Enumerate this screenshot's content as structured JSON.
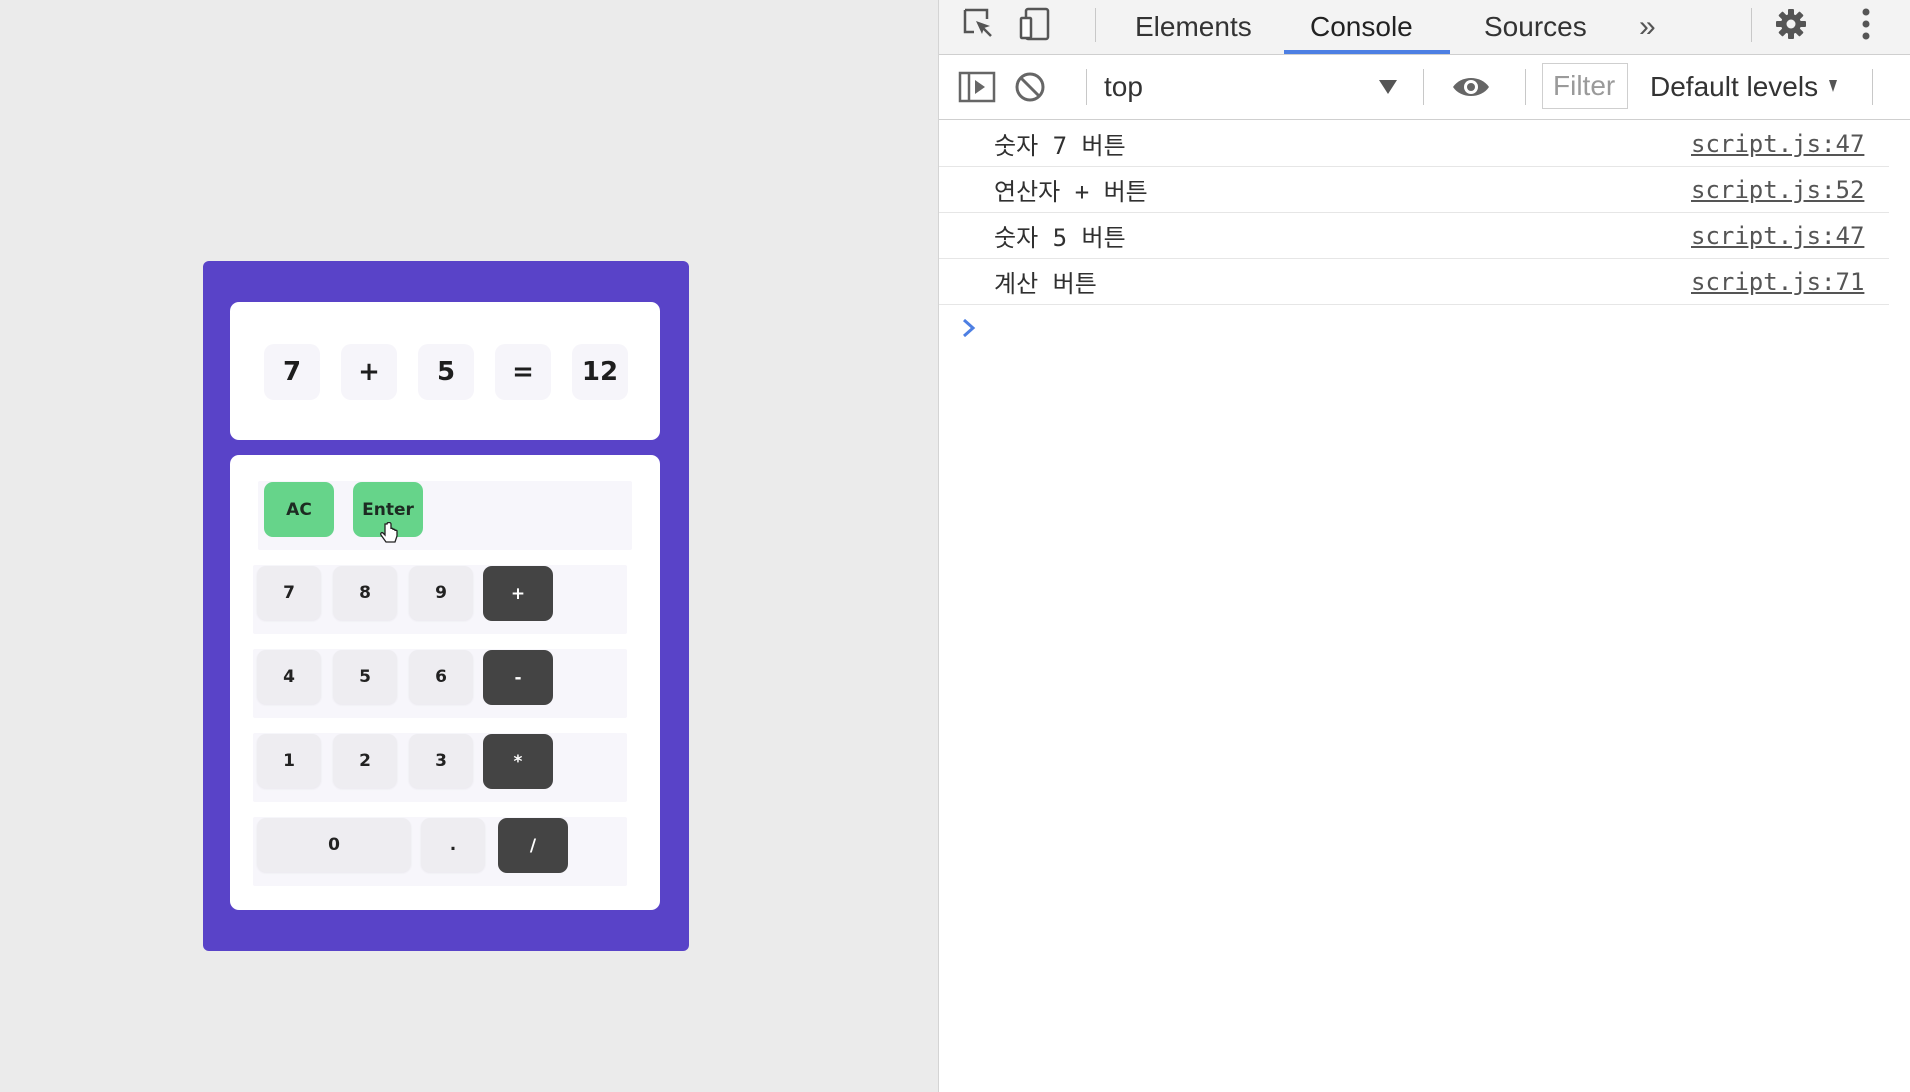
{
  "calculator": {
    "display": [
      "7",
      "+",
      "5",
      "=",
      "12"
    ],
    "function_keys": [
      "AC",
      "Enter"
    ],
    "rows": [
      {
        "nums": [
          "7",
          "8",
          "9"
        ],
        "op": "+"
      },
      {
        "nums": [
          "4",
          "5",
          "6"
        ],
        "op": "-"
      },
      {
        "nums": [
          "1",
          "2",
          "3"
        ],
        "op": "*"
      }
    ],
    "last_row": {
      "zero": "0",
      "dot": ".",
      "op": "/"
    },
    "colors": {
      "frame": "#5943c8",
      "function_key": "#66d48a",
      "operator_key": "#444444"
    }
  },
  "devtools": {
    "tabs": [
      "Elements",
      "Console",
      "Sources"
    ],
    "active_tab": "Console",
    "more_tabs_label": "»",
    "context": "top",
    "filter_placeholder": "Filter",
    "levels_label": "Default levels",
    "logs": [
      {
        "message": "숫자 7 버튼",
        "source": "script.js:47"
      },
      {
        "message": "연산자 + 버튼",
        "source": "script.js:52"
      },
      {
        "message": "숫자 5 버튼",
        "source": "script.js:47"
      },
      {
        "message": "계산 버튼",
        "source": "script.js:71"
      }
    ],
    "icons": [
      "inspect-icon",
      "device-toggle-icon",
      "settings-icon",
      "kebab-menu-icon",
      "sidebar-toggle-icon",
      "clear-console-icon",
      "dropdown-arrow-icon",
      "eye-icon",
      "prompt-chevron-icon"
    ],
    "accent_color": "#4d7fe3"
  }
}
